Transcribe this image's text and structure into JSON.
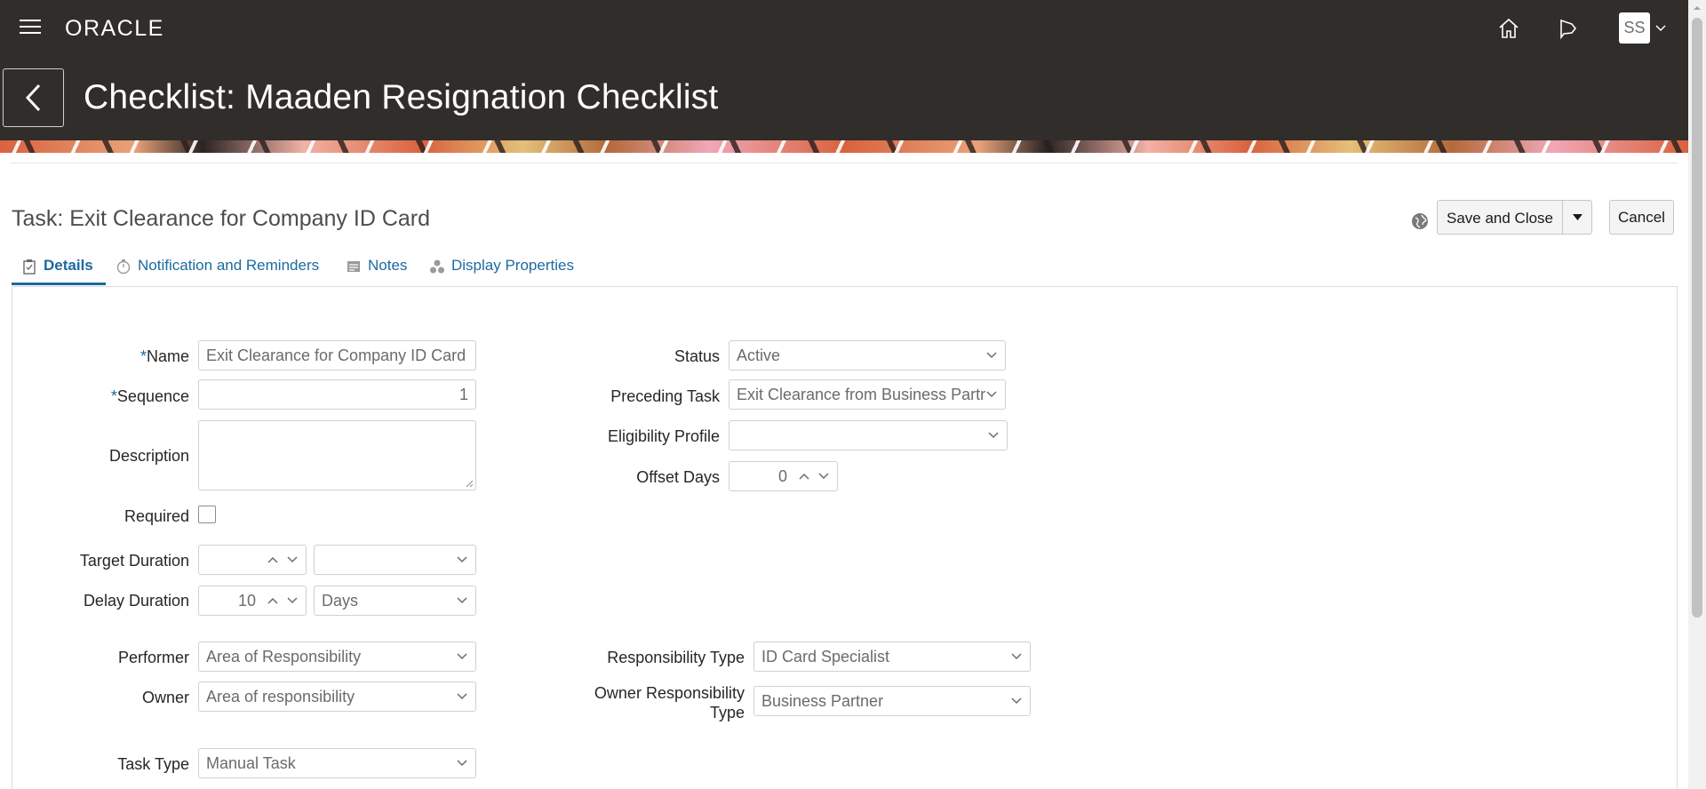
{
  "header": {
    "logo_text": "ORACLE",
    "user_initials": "SS"
  },
  "page": {
    "title": "Checklist: Maaden Resignation Checklist",
    "task_title": "Task: Exit Clearance for Company ID Card"
  },
  "actions": {
    "save_label": "Save and Close",
    "cancel_label": "Cancel"
  },
  "tabs": [
    {
      "label": "Details",
      "icon": "clipboard-icon",
      "active": true
    },
    {
      "label": "Notification and Reminders",
      "icon": "stopwatch-icon",
      "active": false
    },
    {
      "label": "Notes",
      "icon": "note-icon",
      "active": false
    },
    {
      "label": "Display Properties",
      "icon": "shapes-icon",
      "active": false
    }
  ],
  "form": {
    "name": {
      "label": "Name",
      "value": "Exit Clearance for Company ID Card",
      "required": true
    },
    "sequence": {
      "label": "Sequence",
      "value": "1",
      "required": true
    },
    "description": {
      "label": "Description",
      "value": ""
    },
    "required": {
      "label": "Required",
      "checked": false
    },
    "target_duration": {
      "label": "Target Duration",
      "value": "",
      "unit": ""
    },
    "delay_duration": {
      "label": "Delay Duration",
      "value": "10",
      "unit": "Days"
    },
    "performer": {
      "label": "Performer",
      "value": "Area of Responsibility"
    },
    "owner": {
      "label": "Owner",
      "value": "Area of responsibility"
    },
    "task_type": {
      "label": "Task Type",
      "value": "Manual Task"
    },
    "status": {
      "label": "Status",
      "value": "Active"
    },
    "preceding_task": {
      "label": "Preceding Task",
      "value": "Exit Clearance from Business Partr"
    },
    "eligibility_profile": {
      "label": "Eligibility Profile",
      "value": ""
    },
    "offset_days": {
      "label": "Offset Days",
      "value": "0"
    },
    "responsibility_type": {
      "label": "Responsibility Type",
      "value": "ID Card Specialist"
    },
    "owner_responsibility_type": {
      "label_line1": "Owner Responsibility",
      "label_line2": "Type",
      "value": "Business Partner"
    }
  },
  "colors": {
    "header_bg": "#312d2a",
    "link": "#1c6aa0"
  }
}
